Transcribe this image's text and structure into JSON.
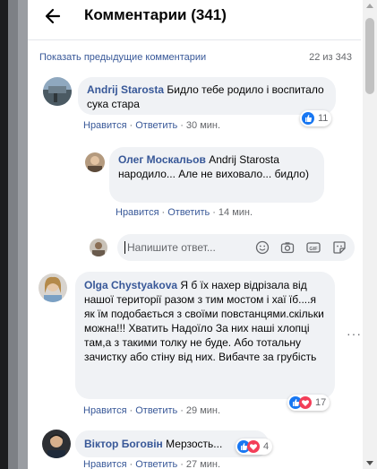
{
  "header": {
    "title": "Комментарии (341)"
  },
  "pagination": {
    "prev_link": "Показать предыдущие комментарии",
    "counter": "22 из 343"
  },
  "comments": [
    {
      "author": "Andrij Starosta",
      "text": "Бидло тебе родило і воспитало сука стара",
      "like": "Нравится",
      "reply": "Ответить",
      "time": "30 мин.",
      "reactions": "11"
    },
    {
      "author": "Олег Москальов",
      "text": "Andrij Starosta народило... Але не виховало... бидло)",
      "like": "Нравится",
      "reply": "Ответить",
      "time": "14 мин."
    },
    {
      "author": "Olga Chystyakova",
      "text": "Я б їх нахер відрізала від нашої території разом з тим мостом і хаї їб....я як їм подобається з своїми повстанцями.скільки можна!!! Хватить Надоїло За них наші хлопці там,а з такими толку не буде. Або тотальну зачистку або стіну від них. Вибачте за грубість",
      "like": "Нравится",
      "reply": "Ответить",
      "time": "29 мин.",
      "reactions": "17"
    },
    {
      "author": "Віктор Боговін",
      "text": "Мерзость...",
      "like": "Нравится",
      "reply": "Ответить",
      "time": "27 мин.",
      "reactions": "4"
    }
  ],
  "reply_box": {
    "placeholder": "Напишите ответ..."
  },
  "icons": {
    "back": "arrow-left-icon",
    "emoji": "emoji-icon",
    "camera": "camera-icon",
    "gif": "gif-icon",
    "sticker": "sticker-icon",
    "more": "more-dots-icon"
  },
  "colors": {
    "link": "#385898",
    "bubble": "#f0f2f5",
    "like": "#1877f2",
    "love": "#f33e58"
  }
}
